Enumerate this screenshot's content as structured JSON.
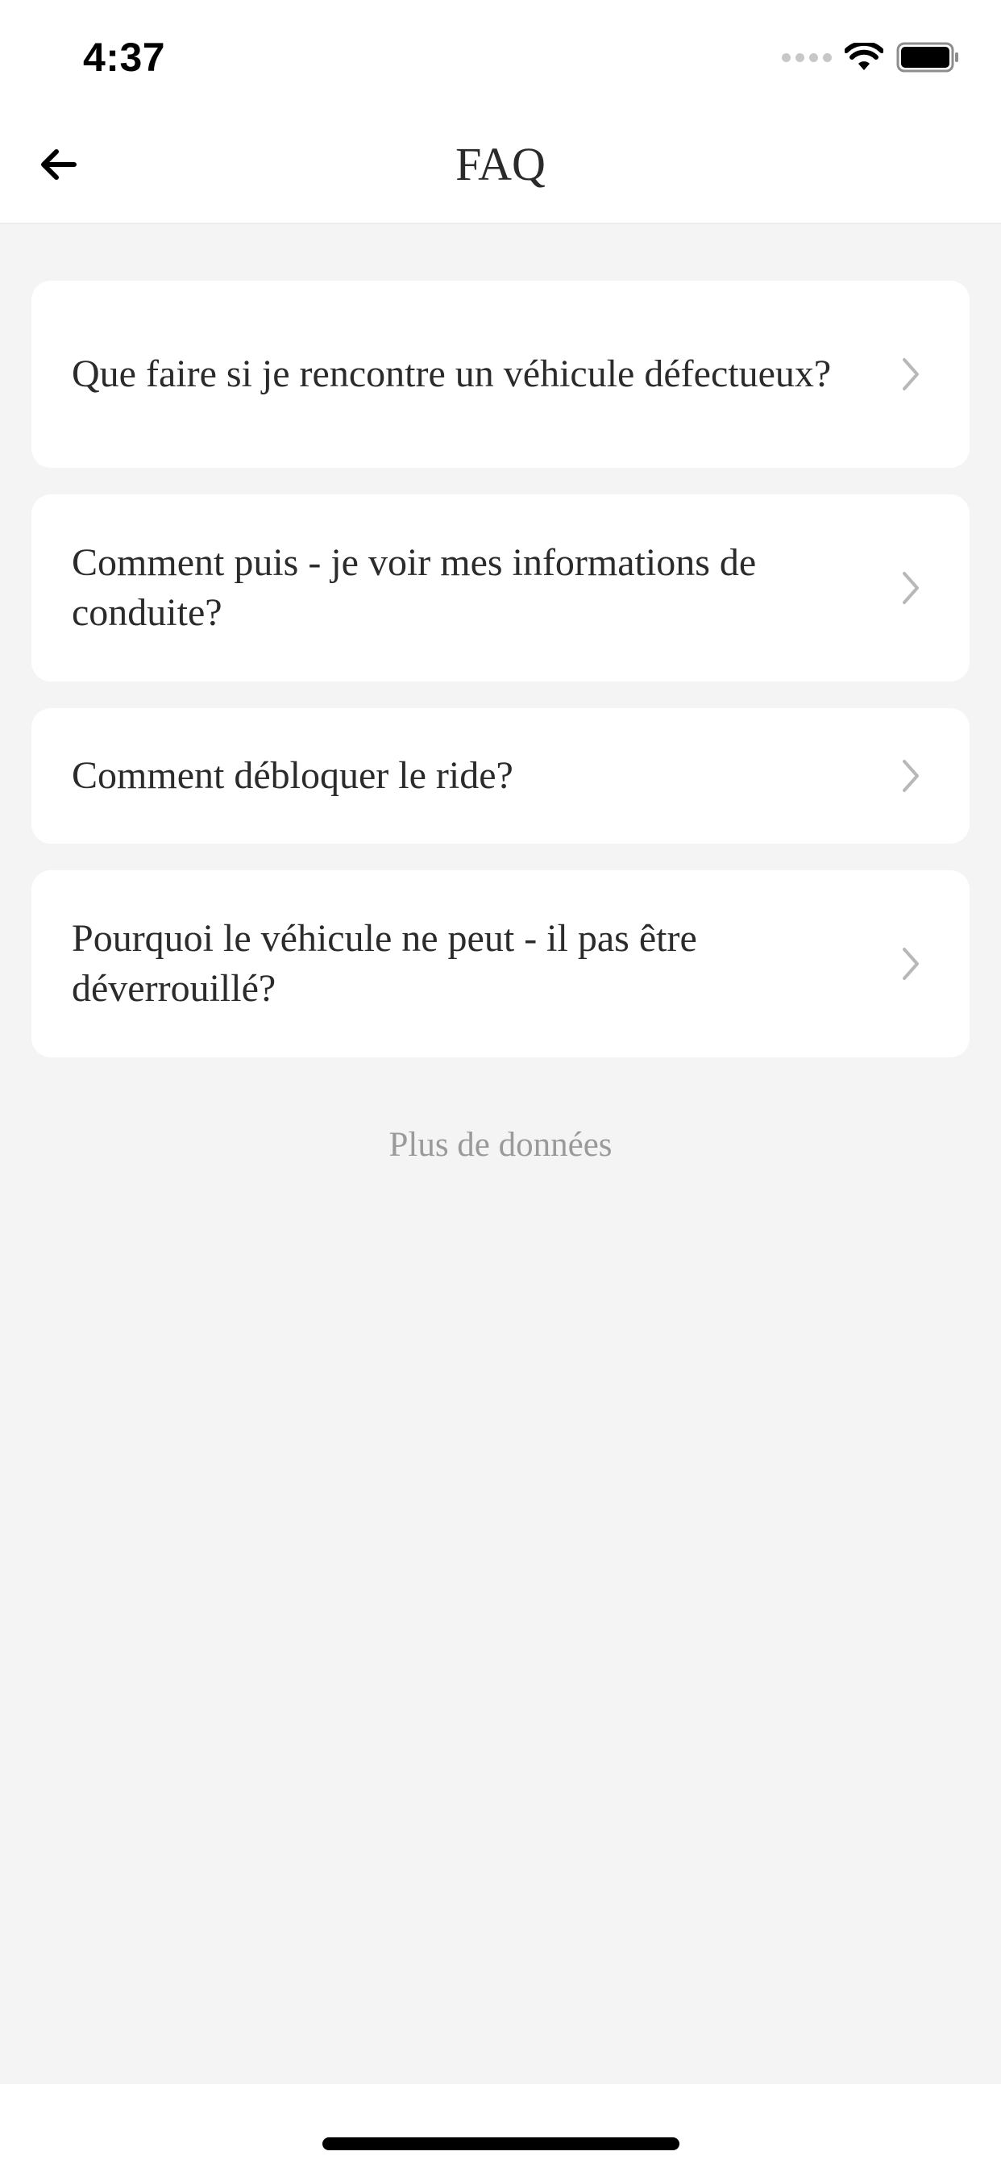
{
  "status_bar": {
    "time": "4:37"
  },
  "header": {
    "title": "FAQ"
  },
  "faq": {
    "items": [
      {
        "question": "Que faire si je rencontre un véhicule défectueux?"
      },
      {
        "question": "Comment puis - je voir mes informations de conduite?"
      },
      {
        "question": "Comment débloquer le ride?"
      },
      {
        "question": "Pourquoi le véhicule ne peut - il pas être déverrouillé?"
      }
    ],
    "more_label": "Plus de données"
  },
  "colors": {
    "background": "#f4f4f4",
    "card": "#ffffff",
    "text": "#2b2b2b",
    "muted": "#9a9a9a",
    "chevron": "#b8b8b8"
  }
}
